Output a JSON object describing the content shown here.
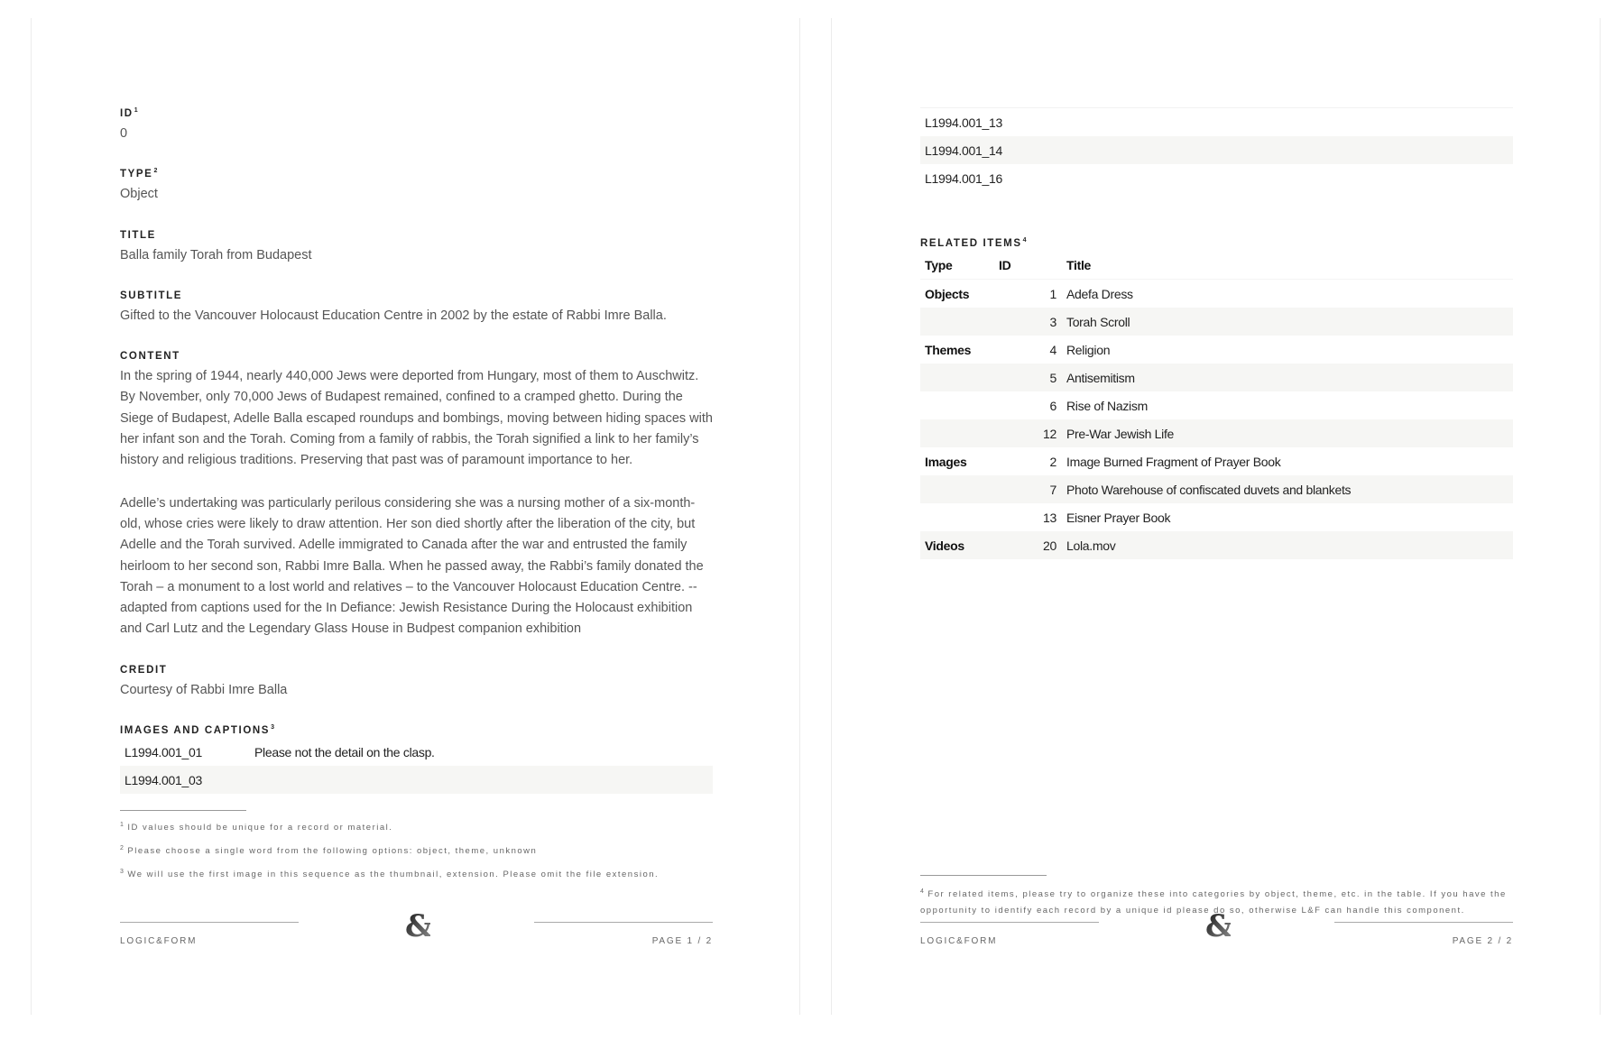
{
  "page1": {
    "fields": [
      {
        "label": "ID",
        "note": "1",
        "value": "0"
      },
      {
        "label": "TYPE",
        "note": "2",
        "value": "Object"
      },
      {
        "label": "TITLE",
        "note": "",
        "value": "Balla family Torah from Budapest"
      },
      {
        "label": "SUBTITLE",
        "note": "",
        "value": "Gifted to the Vancouver Holocaust Education Centre in 2002 by the estate of Rabbi Imre Balla."
      }
    ],
    "content_label": "CONTENT",
    "content_paragraphs": [
      "In the spring of 1944, nearly 440,000 Jews were deported from Hungary, most of them to Auschwitz. By November, only 70,000 Jews of Budapest remained, confined to a cramped ghetto. During the Siege of Budapest, Adelle Balla escaped roundups and bombings, moving between hiding spaces with her infant son and the Torah. Coming from a family of rabbis, the Torah signified a link to her family’s history and religious traditions. Preserving that past was of paramount importance to her.",
      "Adelle’s undertaking was particularly perilous considering she was a nursing mother of a six-month-old, whose cries were likely to draw attention. Her son died shortly after the liberation of the city, but Adelle and the Torah survived. Adelle immigrated to Canada after the war and entrusted the family heirloom to her second son, Rabbi Imre Balla. When he passed away, the Rabbi’s family donated the Torah – a monument to a lost world and relatives – to the Vancouver Holocaust Education Centre. --adapted from captions used for the In Defiance: Jewish Resistance During the Holocaust exhibition and Carl Lutz and the Legendary Glass House in Budpest companion exhibition"
    ],
    "credit_label": "CREDIT",
    "credit_value": "Courtesy of Rabbi Imre Balla",
    "images_label": "IMAGES AND CAPTIONS",
    "images_note": "3",
    "images": [
      {
        "id": "L1994.001_01",
        "caption": "Please not the detail on the clasp."
      },
      {
        "id": "L1994.001_03",
        "caption": ""
      }
    ],
    "footnotes": [
      {
        "n": "1",
        "text": "ID values should be unique for a record or material."
      },
      {
        "n": "2",
        "text": "Please choose a single word from the following options: object, theme, unknown"
      },
      {
        "n": "3",
        "text": "We will use the first image in this sequence as the thumbnail, extension. Please omit the file extension."
      }
    ],
    "footer": {
      "brand": "LOGIC&FORM",
      "page": "PAGE 1 / 2"
    }
  },
  "page2": {
    "images_cont": [
      {
        "id": "L1994.001_13"
      },
      {
        "id": "L1994.001_14"
      },
      {
        "id": "L1994.001_16"
      }
    ],
    "related_label": "RELATED ITEMS",
    "related_note": "4",
    "related_headers": {
      "type": "Type",
      "id": "ID",
      "title": "Title"
    },
    "related": [
      {
        "type": "Objects",
        "id": "1",
        "title": "Adefa Dress"
      },
      {
        "type": "",
        "id": "3",
        "title": "Torah Scroll"
      },
      {
        "type": "Themes",
        "id": "4",
        "title": "Religion"
      },
      {
        "type": "",
        "id": "5",
        "title": "Antisemitism"
      },
      {
        "type": "",
        "id": "6",
        "title": "Rise of Nazism"
      },
      {
        "type": "",
        "id": "12",
        "title": "Pre-War Jewish Life"
      },
      {
        "type": "Images",
        "id": "2",
        "title": "Image Burned Fragment of Prayer Book"
      },
      {
        "type": "",
        "id": "7",
        "title": "Photo Warehouse of confiscated duvets and blankets"
      },
      {
        "type": "",
        "id": "13",
        "title": "Eisner Prayer Book"
      },
      {
        "type": "Videos",
        "id": "20",
        "title": "Lola.mov"
      }
    ],
    "footnotes": [
      {
        "n": "4",
        "text": "For related items, please try to organize these into categories by object, theme, etc. in the table. If you have the opportunity to identify each record by a unique id please do so, otherwise L&F can handle this component."
      }
    ],
    "footer": {
      "brand": "LOGIC&FORM",
      "page": "PAGE 2 / 2"
    }
  },
  "logo_glyph": "&",
  "colors": {
    "text": "#222222",
    "muted": "#555555",
    "stripe": "#f6f6f4"
  }
}
